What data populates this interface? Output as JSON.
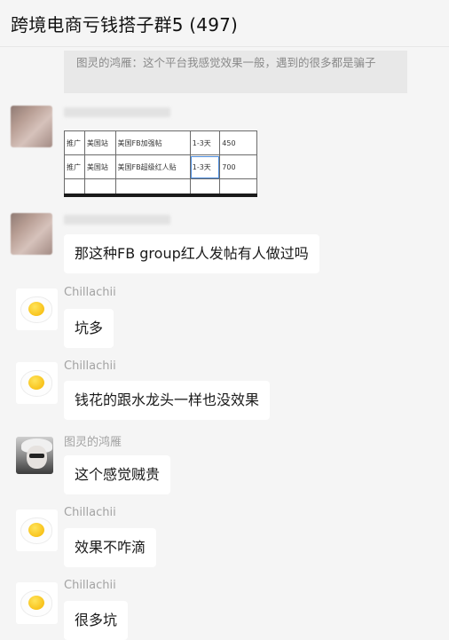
{
  "header": {
    "title": "跨境电商亏钱搭子群5 (497)"
  },
  "quote": {
    "text": "图灵的鸿雁：这个平台我感觉效果一般，遇到的很多都是骗子"
  },
  "image_message": {
    "rows": [
      [
        "推广",
        "美国站",
        "美国FB加强帖",
        "1-3天",
        "450"
      ],
      [
        "推广",
        "美国站",
        "美国FB超级红人贴",
        "1-3天",
        "700"
      ]
    ]
  },
  "messages": [
    {
      "sender": "",
      "text": "那这种FB group红人发帖有人做过吗"
    },
    {
      "sender": "Chillachii",
      "text": "坑多"
    },
    {
      "sender": "Chillachii",
      "text": "钱花的跟水龙头一样也没效果"
    },
    {
      "sender": "图灵的鸿雁",
      "text": "这个感觉贼贵"
    },
    {
      "sender": "Chillachii",
      "text": "效果不咋滴"
    },
    {
      "sender": "Chillachii",
      "text": "很多坑"
    }
  ]
}
